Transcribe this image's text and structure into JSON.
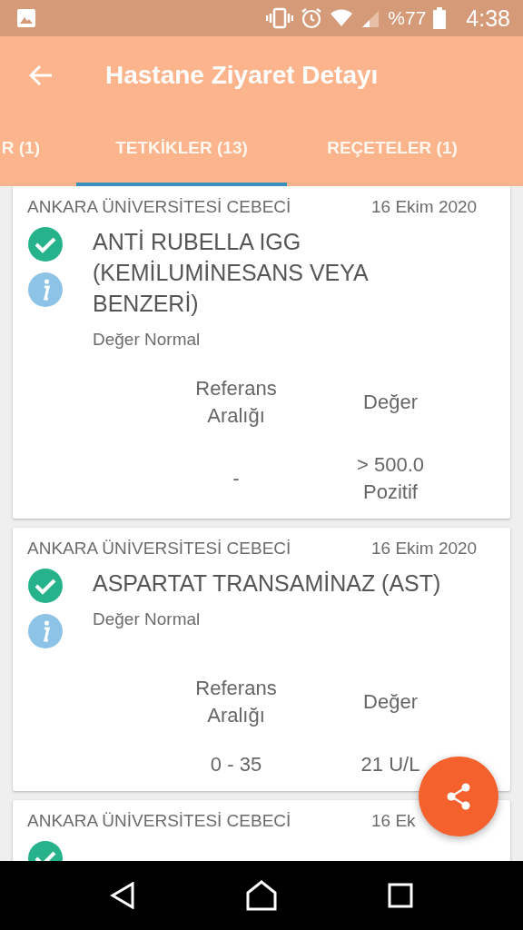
{
  "status_bar": {
    "battery": "%77",
    "time": "4:38"
  },
  "app_bar": {
    "title": "Hastane Ziyaret Detayı"
  },
  "tabs": [
    {
      "label": "R (1)",
      "selected": false
    },
    {
      "label": "TETKİKLER (13)",
      "selected": true
    },
    {
      "label": "REÇETELER (1)",
      "selected": false
    }
  ],
  "cards": [
    {
      "hospital": "ANKARA ÜNİVERSİTESİ CEBECİ",
      "date": "16 Ekim 2020",
      "title": "ANTİ RUBELLA IGG (KEMİLUMİNESANS VEYA BENZERİ)",
      "note": "Değer Normal",
      "ref_header": "Referans Aralığı",
      "value_header": "Değer",
      "ref": "-",
      "value": "> 500.0 Pozitif"
    },
    {
      "hospital": "ANKARA ÜNİVERSİTESİ CEBECİ",
      "date": "16 Ekim 2020",
      "title": "ASPARTAT TRANSAMİNAZ (AST)",
      "note": "Değer Normal",
      "ref_header": "Referans Aralığı",
      "value_header": "Değer",
      "ref": "0 - 35",
      "value": "21 U/L"
    },
    {
      "hospital": "ANKARA ÜNİVERSİTESİ CEBECİ",
      "date": "16 Ek"
    }
  ]
}
